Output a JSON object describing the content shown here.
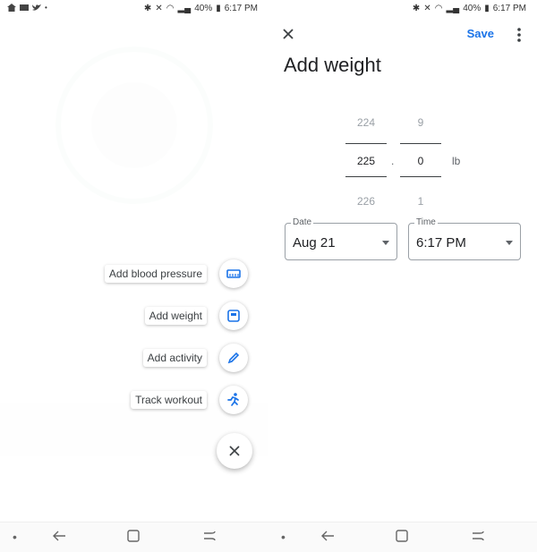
{
  "left_screen": {
    "status": {
      "battery": "40%",
      "time": "6:17 PM"
    },
    "menu_items": [
      {
        "label": "Add blood pressure",
        "icon": "blood-pressure-cuff-icon"
      },
      {
        "label": "Add weight",
        "icon": "scale-icon"
      },
      {
        "label": "Add activity",
        "icon": "pencil-icon"
      },
      {
        "label": "Track workout",
        "icon": "running-person-icon"
      }
    ],
    "close_icon": "close-icon"
  },
  "right_screen": {
    "status": {
      "battery": "40%",
      "time": "6:17 PM"
    },
    "header": {
      "save_label": "Save",
      "title": "Add weight"
    },
    "weight_picker": {
      "whole": {
        "above": "224",
        "selected": "225",
        "below": "226"
      },
      "decimal": {
        "above": "9",
        "selected": "0",
        "below": "1"
      },
      "separator": ".",
      "unit": "lb"
    },
    "date_field": {
      "label": "Date",
      "value": "Aug 21"
    },
    "time_field": {
      "label": "Time",
      "value": "6:17 PM"
    }
  },
  "colors": {
    "accent": "#1a73e8",
    "text": "#202124",
    "muted": "#9aa0a6"
  }
}
